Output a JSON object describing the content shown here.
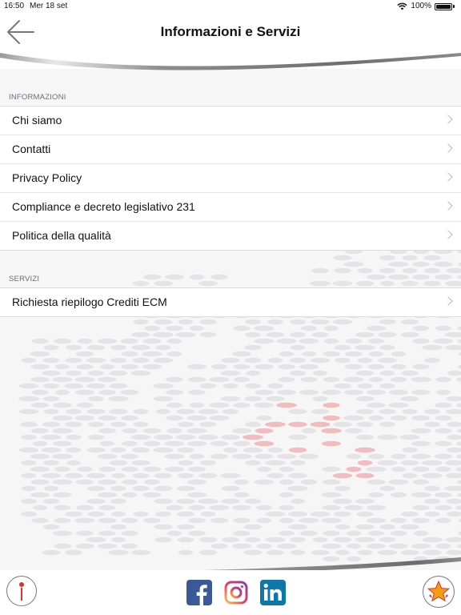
{
  "status_bar": {
    "time": "16:50",
    "date": "Mer 18 set",
    "battery_text": "100%",
    "icons": [
      "wifi-icon",
      "battery-icon"
    ]
  },
  "header": {
    "title": "Informazioni e Servizi",
    "back_icon": "back-arrow-icon"
  },
  "sections": [
    {
      "title": "INFORMAZIONI",
      "items": [
        {
          "label": "Chi siamo"
        },
        {
          "label": "Contatti"
        },
        {
          "label": "Privacy Policy"
        },
        {
          "label": "Compliance e decreto legislativo 231"
        },
        {
          "label": "Politica della qualità"
        }
      ]
    },
    {
      "title": "SERVIZI",
      "items": [
        {
          "label": "Richiesta riepilogo Crediti ECM"
        }
      ]
    }
  ],
  "bottom_bar": {
    "info_icon": "info-icon",
    "social_icons": [
      "facebook-icon",
      "instagram-icon",
      "linkedin-icon"
    ],
    "favorites_icon": "star-favorites-icon"
  },
  "colors": {
    "facebook": "#3b5998",
    "linkedin": "#0e76a8",
    "accent_red": "#d9342b",
    "star_orange": "#f39c12"
  }
}
